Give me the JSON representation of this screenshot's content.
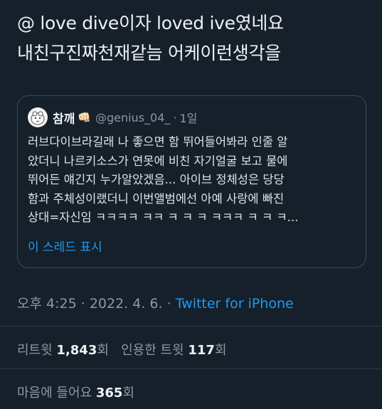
{
  "tweet": {
    "line1": "@ love dive이자 loved ive였네요",
    "line2": "내친구진짜천재같늠 어케이런생각을"
  },
  "quote": {
    "author_name": "참깨",
    "author_emoji": "👊🏻",
    "author_handle": "@genius_04_",
    "dot": "·",
    "time": "1일",
    "lines": [
      "러브다이브라길래 나 좋으면 함 뛰어들어봐라 인줄 알",
      "았더니 나르키소스가 연못에 비친 자기얼굴 보고 물에",
      "뛰어든 얘긴지 누가알았겠음... 아이브 정체성은 당당",
      "함과 주체성이랬더니 이번앨범에선 아예 사랑에 빠진",
      "상대=자신임 ㅋㅋㅋㅋ ㅋㅋ ㅋ ㅋ ㅋ ㅋㅋㅋ ㅋ ㅋ ㅋ..."
    ],
    "thread_link": "이 스레드 표시"
  },
  "meta": {
    "time": "오후 4:25",
    "sep1": "·",
    "date": "2022. 4. 6.",
    "sep2": "·",
    "source": "Twitter for iPhone"
  },
  "stats": {
    "retweets_label": "리트윗",
    "retweets_count": "1,843",
    "retweets_unit": "회",
    "quotes_label": "인용한 트윗",
    "quotes_count": "117",
    "quotes_unit": "회",
    "likes_label": "마음에 들어요",
    "likes_count": "365",
    "likes_unit": "회"
  },
  "colors": {
    "background": "#15202b",
    "link": "#1d9bf0",
    "muted": "#8b98a5"
  }
}
